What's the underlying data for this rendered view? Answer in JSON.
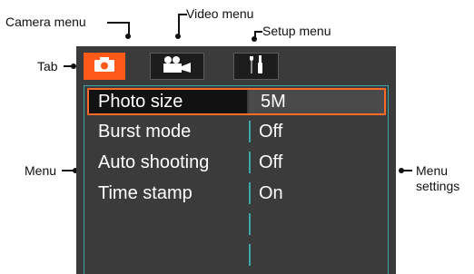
{
  "callouts": {
    "camera_menu": "Camera menu",
    "video_menu": "Video menu",
    "setup_menu": "Setup menu",
    "tab": "Tab",
    "menu": "Menu",
    "menu_settings_line1": "Menu",
    "menu_settings_line2": "settings"
  },
  "tabs": [
    {
      "icon": "camera-icon",
      "active": true
    },
    {
      "icon": "video-camera-icon",
      "active": false
    },
    {
      "icon": "wrench-screwdriver-icon",
      "active": false
    }
  ],
  "menu": {
    "selected_index": 0,
    "items": [
      {
        "name": "Photo size",
        "value": "5M"
      },
      {
        "name": "Burst mode",
        "value": "Off"
      },
      {
        "name": "Auto shooting",
        "value": "Off"
      },
      {
        "name": "Time stamp",
        "value": "On"
      }
    ]
  },
  "colors": {
    "screen_bg": "#3b3b3b",
    "accent_orange": "#ff5a1a",
    "panel_border": "#3aa6a6"
  }
}
